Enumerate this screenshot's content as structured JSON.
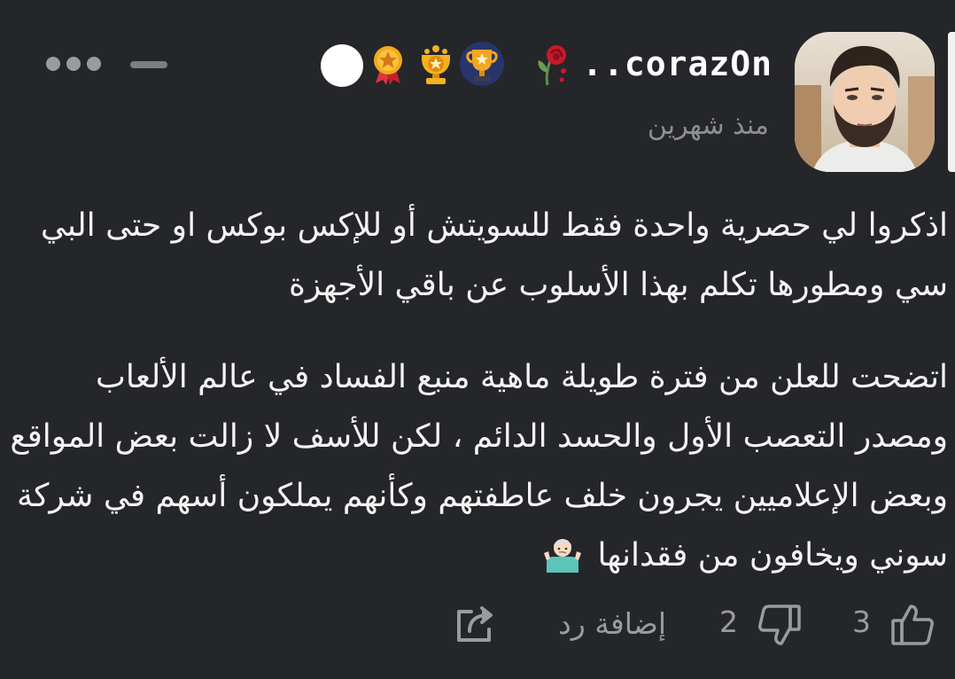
{
  "post": {
    "username": "..corazOn",
    "time_ago": "منذ شهرين",
    "badges": [
      "rose-icon",
      "trophy-cup-icon",
      "gold-trophy-icon",
      "medal-star-icon",
      "status-dot"
    ],
    "paragraphs": [
      "اذكروا لي حصرية واحدة فقط للسويتش أو للإكس بوكس او حتى البي سي ومطورها تكلم بهذا الأسلوب عن باقي الأجهزة",
      "اتضحت للعلن من فترة طويلة ماهية منبع الفساد في عالم الألعاب ومصدر التعصب الأول والحسد الدائم ، لكن للأسف لا زالت بعض المواقع وبعض الإعلاميين يجرون خلف عاطفتهم وكأنهم يملكون أسهم في شركة سوني ويخافون من فقدانها"
    ],
    "paragraph2_emoji": "shrug-emoji"
  },
  "footer": {
    "like_count": "3",
    "dislike_count": "2",
    "reply_label": "إضافة رد"
  },
  "colors": {
    "background": "#252629",
    "text": "#f4f4f4",
    "muted": "#9a9ba0"
  }
}
